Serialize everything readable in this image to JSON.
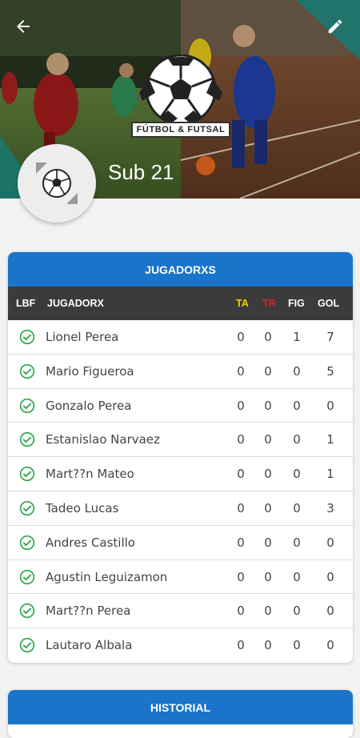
{
  "team": {
    "name": "Sub 21",
    "logo_text": "FÚTBOL & FUTSAL"
  },
  "icons": {
    "back": "arrow-left-icon",
    "edit": "pencil-icon",
    "check": "check-circle-icon",
    "ball": "soccer-ball-icon"
  },
  "colors": {
    "accent": "#1a74c9",
    "header_dark": "#3b3b3b",
    "ta": "#f2d200",
    "tr": "#e02020",
    "check": "#2aa84a"
  },
  "players_section": {
    "title": "JUGADORXS",
    "columns": {
      "lbf": "LBF",
      "name": "JUGADORX",
      "ta": "TA",
      "tr": "TR",
      "fig": "FIG",
      "gol": "GOL"
    },
    "rows": [
      {
        "name": "Lionel Perea",
        "ta": "0",
        "tr": "0",
        "fig": "1",
        "gol": "7"
      },
      {
        "name": "Mario Figueroa",
        "ta": "0",
        "tr": "0",
        "fig": "0",
        "gol": "5"
      },
      {
        "name": "Gonzalo Perea",
        "ta": "0",
        "tr": "0",
        "fig": "0",
        "gol": "0"
      },
      {
        "name": "Estanislao Narvaez",
        "ta": "0",
        "tr": "0",
        "fig": "0",
        "gol": "1"
      },
      {
        "name": "Mart??n Mateo",
        "ta": "0",
        "tr": "0",
        "fig": "0",
        "gol": "1"
      },
      {
        "name": "Tadeo Lucas",
        "ta": "0",
        "tr": "0",
        "fig": "0",
        "gol": "3"
      },
      {
        "name": "Andres Castillo",
        "ta": "0",
        "tr": "0",
        "fig": "0",
        "gol": "0"
      },
      {
        "name": "Agustin Leguizamon",
        "ta": "0",
        "tr": "0",
        "fig": "0",
        "gol": "0"
      },
      {
        "name": "Mart??n Perea",
        "ta": "0",
        "tr": "0",
        "fig": "0",
        "gol": "0"
      },
      {
        "name": "Lautaro Albala",
        "ta": "0",
        "tr": "0",
        "fig": "0",
        "gol": "0"
      }
    ]
  },
  "history_section": {
    "title": "HISTORIAL"
  }
}
